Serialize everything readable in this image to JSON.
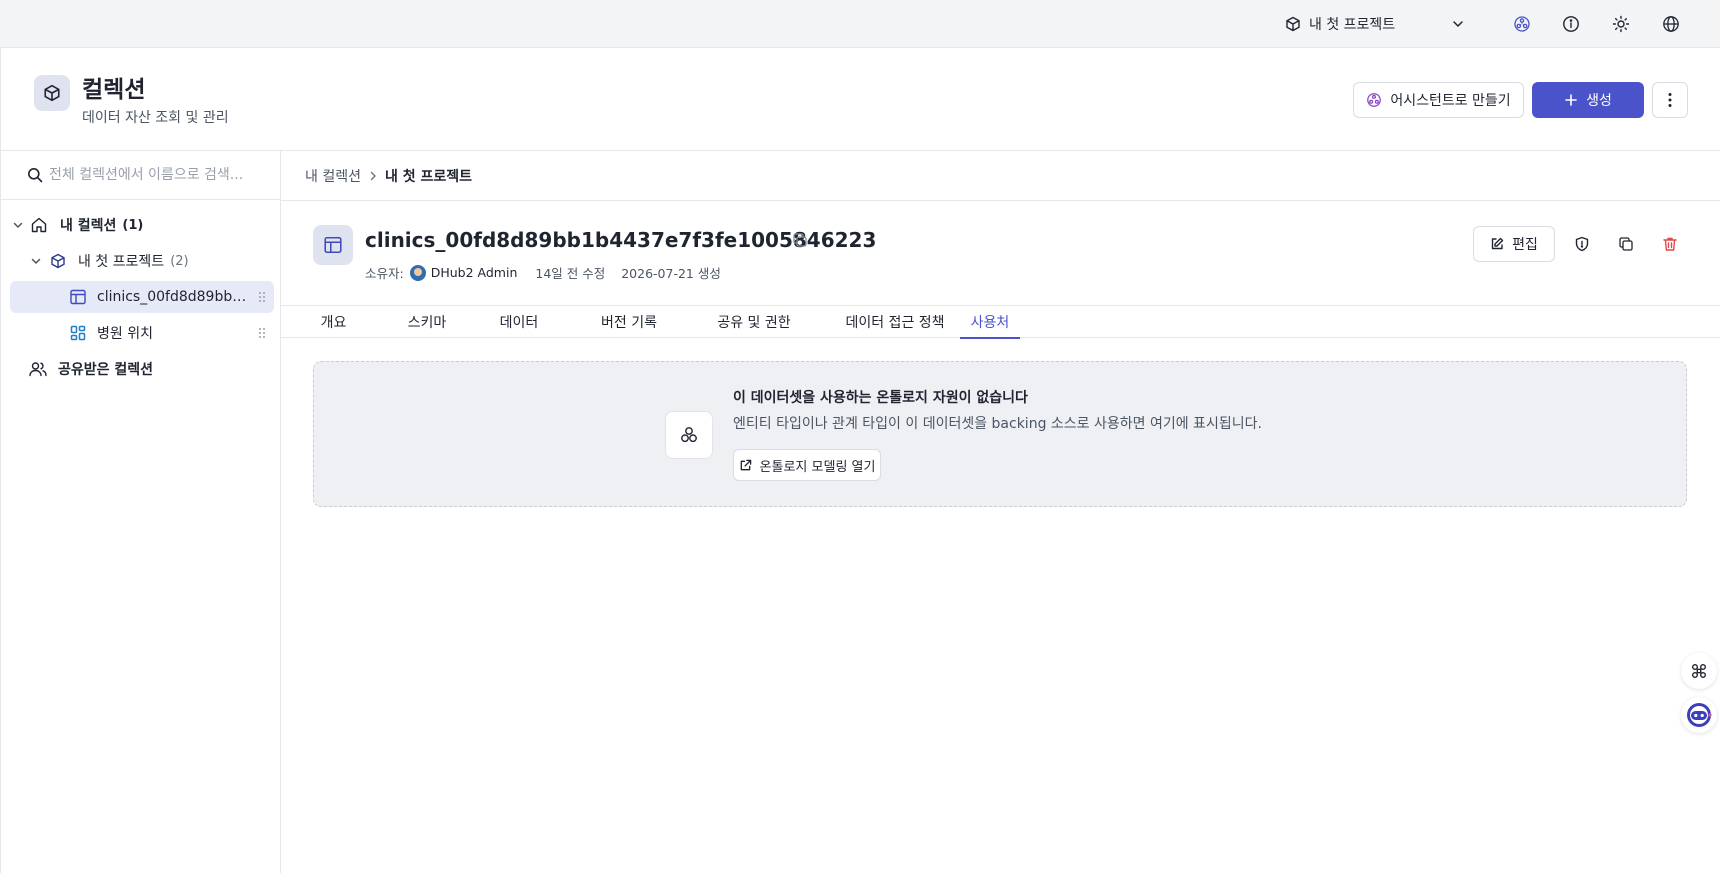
{
  "topbar": {
    "project_selector": "내 첫 프로젝트",
    "icons": [
      "cube-icon",
      "chevron-down-icon",
      "ontology-icon",
      "info-icon",
      "sun-icon",
      "globe-icon"
    ]
  },
  "header": {
    "title": "컬렉션",
    "subtitle": "데이터 자산 조회 및 관리",
    "assistant_button": "어시스턴트로 만들기",
    "create_button": "생성"
  },
  "sidebar": {
    "search_placeholder": "전체 컬렉션에서 이름으로 검색...",
    "my_collections": {
      "label": "내 컬렉션",
      "count": "(1)"
    },
    "project": {
      "label": "내 첫 프로젝트",
      "count": "(2)"
    },
    "items": [
      {
        "label": "clinics_00fd8d89bb1b4437e7f3fe1005846223",
        "icon": "table-icon"
      },
      {
        "label": "병원 위치",
        "icon": "dashboard-icon"
      }
    ],
    "shared": {
      "label": "공유받은 컬렉션"
    }
  },
  "breadcrumb": {
    "parent": "내 컬렉션",
    "current": "내 첫 프로젝트"
  },
  "dataset": {
    "name": "clinics_00fd8d89bb1b4437e7f3fe1005846223",
    "owner_label": "소유자:",
    "owner": "DHub2 Admin",
    "modified": "14일 전 수정",
    "created": "2026-07-21 생성",
    "edit_button": "편집"
  },
  "tabs": [
    {
      "label": "개요"
    },
    {
      "label": "스키마"
    },
    {
      "label": "데이터"
    },
    {
      "label": "버전 기록"
    },
    {
      "label": "공유 및 권한"
    },
    {
      "label": "데이터 접근 정책"
    },
    {
      "label": "사용처",
      "active": true
    }
  ],
  "empty_state": {
    "title": "이 데이터셋을 사용하는 온톨로지 자원이 없습니다",
    "description": "엔티티 타입이나 관계 타입이 이 데이터셋을 backing 소스로 사용하면 여기에 표시됩니다.",
    "button": "온톨로지 모델링 열기"
  },
  "colors": {
    "accent": "#4a53c9",
    "danger": "#e04848",
    "selected_bg": "#e6e9f7"
  }
}
